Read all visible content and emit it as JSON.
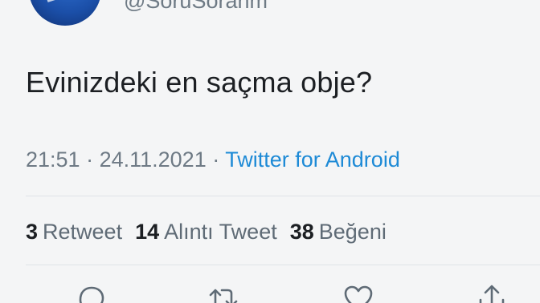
{
  "author": {
    "handle": "@SoruSoranm"
  },
  "tweet": {
    "text": "Evinizdeki en saçma obje?",
    "time": "21:51",
    "separator": " · ",
    "date": "24.11.2021",
    "source": "Twitter for Android"
  },
  "stats": {
    "retweets": {
      "count": "3",
      "label": "Retweet"
    },
    "quotes": {
      "count": "14",
      "label": "Alıntı Tweet"
    },
    "likes": {
      "count": "38",
      "label": "Beğeni"
    }
  },
  "actions": {
    "reply_icon": "reply-icon",
    "retweet_icon": "retweet-icon",
    "like_icon": "heart-icon",
    "share_icon": "share-icon"
  },
  "colors": {
    "link": "#1d8ad6",
    "muted": "#6e7a85",
    "text": "#1c1f23",
    "background": "#f4f5f6"
  }
}
